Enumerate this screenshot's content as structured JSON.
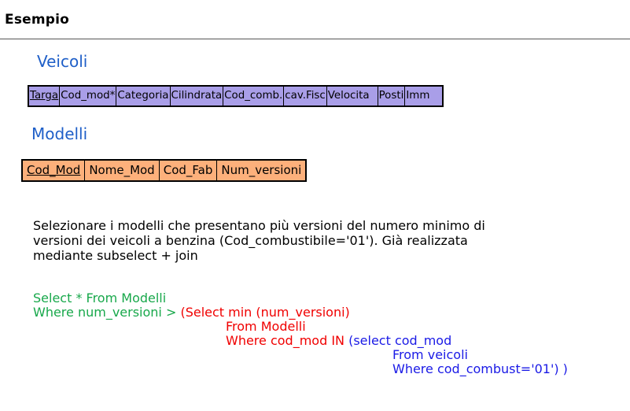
{
  "header": {
    "title": "Esempio"
  },
  "veicoli": {
    "title": "Veicoli",
    "columns": [
      "Targa",
      "Cod_mod*",
      "Categoria",
      "Cilindrata",
      "Cod_comb.",
      "cav.Fisc",
      "Velocita",
      "Posti",
      "Imm"
    ],
    "fill_color": "#a99ee8"
  },
  "modelli": {
    "title": "Modelli",
    "columns": [
      "Cod_Mod",
      "Nome_Mod",
      "Cod_Fab",
      "Num_versioni"
    ],
    "fill_color": "#fdb07b"
  },
  "description": {
    "lines": [
      "Selezionare i modelli che presentano più versioni del numero minimo di",
      "versioni dei veicoli a benzina (Cod_combustibile='01'). Già realizzata",
      "mediante subselect + join"
    ]
  },
  "query": {
    "outer_select": "Select * From Modelli",
    "outer_where": "Where num_versioni > ",
    "mid_select": "(Select min (num_versioni)",
    "mid_from": "From Modelli",
    "mid_where": "Where cod_mod IN ",
    "inner_select": "(select cod_mod",
    "inner_from": "From veicoli",
    "inner_where": "Where cod_combust='01') )",
    "colors": {
      "outer": "#18a84b",
      "middle": "#f00000",
      "inner": "#1a1ae6"
    }
  }
}
